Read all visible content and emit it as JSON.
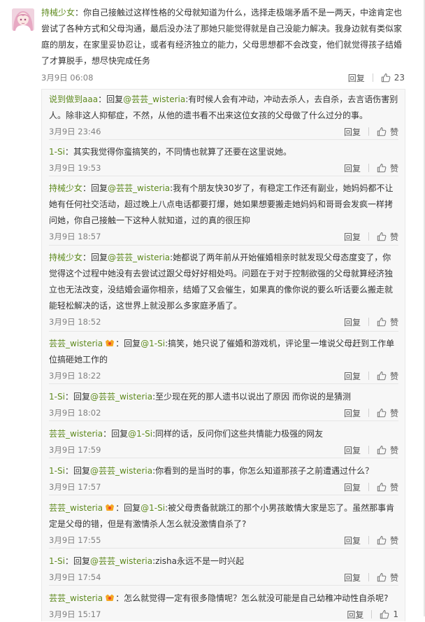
{
  "main_comment": {
    "username": "持械少女",
    "separator": "：",
    "text": "你自己接触过这样性格的父母就知道为什么，选择走极端矛盾不是一两天，中途肯定也尝试了各种方式和父母沟通，最后没办法了那她只能觉得就是自己没能力解决。我身边就有类似家庭的朋友，在家里妥协忍让，或者有经济独立的能力，父母思想都不会改变，他们就觉得孩子结婚了才算脱手，想尽快完成任务",
    "time": "3月9日 06:08",
    "reply_label": "回复",
    "like_count": "23"
  },
  "replies": [
    {
      "username": "说到做到aaa",
      "vip": false,
      "sep": "：",
      "reply_prefix": "回复",
      "mention": "@芸芸_wisteria",
      "colon": ":",
      "text": "有时候人会有冲动，冲动去杀人，去自杀，去言语伤害别人。除非这人抑郁症，不然，从他的遗书看不出来这位女孩的父母做了什么过分的事。",
      "time": "3月9日 23:46",
      "reply_label": "回复",
      "like_label": "赞"
    },
    {
      "username": "1-Si",
      "vip": false,
      "sep": "：",
      "reply_prefix": "",
      "mention": "",
      "colon": "",
      "text": "其实我觉得你蛮搞笑的，不同情也就算了还要在这里说她。",
      "time": "3月9日 19:53",
      "reply_label": "回复",
      "like_label": "赞"
    },
    {
      "username": "持械少女",
      "vip": false,
      "sep": "：",
      "reply_prefix": "回复",
      "mention": "@芸芸_wisteria",
      "colon": ":",
      "text": "我有个朋友快30岁了，有稳定工作还有副业，她妈妈都不让她有任何社交活动，超过晚上八点电话都要打爆，她如果想要搬走她妈妈和哥哥会发疯一样拷问她，你自己接触一下这种人就知道，过的真的很压抑",
      "time": "3月9日 18:57",
      "reply_label": "回复",
      "like_label": "赞"
    },
    {
      "username": "持械少女",
      "vip": false,
      "sep": "：",
      "reply_prefix": "回复",
      "mention": "@芸芸_wisteria",
      "colon": ":",
      "text": "她都说了两年前从开始催婚相亲时就发现父母态度变了，你觉得这个过程中她没有去尝试过跟父母好好相处吗。问题在于对于控制欲强的父母就算经济独立也无法改变，没结婚会逼你相亲，结婚了又会催生，如果真的像你说的要么听话要么搬走就能轻松解决的话，这世界上就没那么多家庭矛盾了。",
      "time": "3月9日 18:52",
      "reply_label": "回复",
      "like_label": "赞"
    },
    {
      "username": "芸芸_wisteria",
      "vip": true,
      "sep": "：",
      "reply_prefix": "回复",
      "mention": "@1-Si",
      "colon": ":",
      "text": "搞笑，她只说了催婚和游戏机，评论里一堆说父母赶到工作单位搞砸她工作的",
      "time": "3月9日 18:22",
      "reply_label": "回复",
      "like_label": "赞"
    },
    {
      "username": "1-Si",
      "vip": false,
      "sep": "：",
      "reply_prefix": "回复",
      "mention": "@芸芸_wisteria",
      "colon": ":",
      "text": "至少现在死的那人遗书以说出了原因 而你说的是猜测",
      "time": "3月9日 18:02",
      "reply_label": "回复",
      "like_label": "赞"
    },
    {
      "username": "芸芸_wisteria",
      "vip": true,
      "sep": "：",
      "reply_prefix": "回复",
      "mention": "@1-Si",
      "colon": ":",
      "text": "同样的话，反问你们这些共情能力极强的网友",
      "time": "3月9日 17:59",
      "reply_label": "回复",
      "like_label": "赞"
    },
    {
      "username": "1-Si",
      "vip": false,
      "sep": "：",
      "reply_prefix": "回复",
      "mention": "@芸芸_wisteria",
      "colon": ":",
      "text": "你看到的是当时的事，你怎么知道那孩子之前遭遇过什么？",
      "time": "3月9日 17:57",
      "reply_label": "回复",
      "like_label": "赞"
    },
    {
      "username": "芸芸_wisteria",
      "vip": true,
      "sep": "：",
      "reply_prefix": "回复",
      "mention": "@1-Si",
      "colon": ":",
      "text": "被父母责备就跳江的那个小男孩敢情大家是忘了。虽然那事肯定是父母的错，但是有激情杀人怎么就没激情自杀了?",
      "time": "3月9日 17:55",
      "reply_label": "回复",
      "like_label": "赞"
    },
    {
      "username": "1-Si",
      "vip": false,
      "sep": "：",
      "reply_prefix": "回复",
      "mention": "@芸芸_wisteria",
      "colon": ":",
      "text": "zisha永远不是一时兴起",
      "time": "3月9日 17:54",
      "reply_label": "回复",
      "like_label": "赞"
    },
    {
      "username": "芸芸_wisteria",
      "vip": true,
      "sep": "：",
      "reply_prefix": "",
      "mention": "",
      "colon": "",
      "text": "怎么就觉得一定有很多隐情呢？怎么就没可能是自己幼稚冲动性自杀呢?",
      "time": "3月9日 15:17",
      "reply_label": "回复",
      "like_label": "1"
    }
  ],
  "colors": {
    "username": "#5e8a1e",
    "text": "#333333",
    "meta": "#808080",
    "reply_bg": "#f7f7f7"
  },
  "icons": {
    "like": "thumbs-up-icon",
    "vip": "vip-badge-icon",
    "avatar": "user-avatar"
  }
}
